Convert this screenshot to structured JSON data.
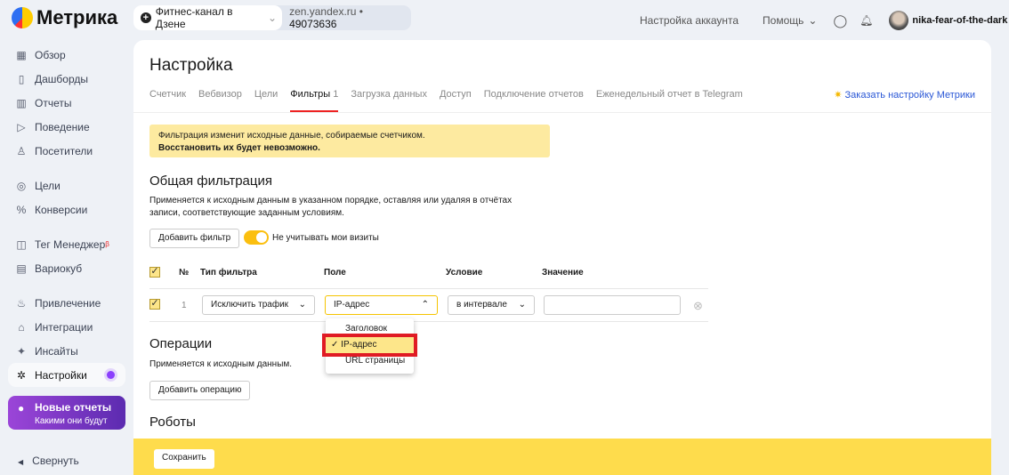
{
  "header": {
    "logo": "Метрика",
    "counter_name": "Фитнес-канал в Дзене",
    "counter_domain": "zen.yandex.ru",
    "counter_id": "49073636",
    "account_settings": "Настройка аккаунта",
    "help": "Помощь",
    "username": "nika-fear-of-the-dark"
  },
  "sidebar": {
    "items": [
      {
        "label": "Обзор",
        "icon": "▦"
      },
      {
        "label": "Дашборды",
        "icon": "▯"
      },
      {
        "label": "Отчеты",
        "icon": "▥"
      },
      {
        "label": "Поведение",
        "icon": "▷"
      },
      {
        "label": "Посетители",
        "icon": "♙"
      },
      {
        "label": "Цели",
        "icon": "◎"
      },
      {
        "label": "Конверсии",
        "icon": "%"
      },
      {
        "label": "Тег Менеджер",
        "icon": "◫",
        "badge": "β"
      },
      {
        "label": "Вариокуб",
        "icon": "▤"
      },
      {
        "label": "Привлечение",
        "icon": "♨"
      },
      {
        "label": "Интеграции",
        "icon": "⌂"
      },
      {
        "label": "Инсайты",
        "icon": "✦"
      },
      {
        "label": "Настройки",
        "icon": "✲"
      }
    ],
    "promo_title": "Новые отчеты",
    "promo_sub": "Какими они будут",
    "collapse": "Свернуть"
  },
  "main": {
    "title": "Настройка",
    "tabs": [
      "Счетчик",
      "Вебвизор",
      "Цели",
      "Фильтры",
      "Загрузка данных",
      "Доступ",
      "Подключение отчетов",
      "Еженедельный отчет в Telegram"
    ],
    "filters_count": "1",
    "order_link": "Заказать настройку Метрики",
    "warning_1": "Фильтрация изменит исходные данные, собираемые счетчиком.",
    "warning_2": "Восстановить их будет невозможно.",
    "general_title": "Общая фильтрация",
    "general_desc": "Применяется к исходным данным в указанном порядке, оставляя или удаляя в отчётах записи, соответствующие заданным условиям.",
    "add_filter": "Добавить фильтр",
    "ignore_visits": "Не учитывать мои визиты",
    "ignore_visits_on": true,
    "columns": [
      "№",
      "Тип фильтра",
      "Поле",
      "Условие",
      "Значение"
    ],
    "row": {
      "num": "1",
      "type": "Исключить трафик",
      "field": "IP-адрес",
      "condition": "в интервале",
      "value": ""
    },
    "field_options": [
      "Заголовок",
      "IP-адрес",
      "URL страницы"
    ],
    "operations_title": "Операции",
    "operations_desc": "Применяется к исходным данным.",
    "add_operation": "Добавить операцию",
    "robots_title": "Роботы",
    "save": "Сохранить"
  }
}
